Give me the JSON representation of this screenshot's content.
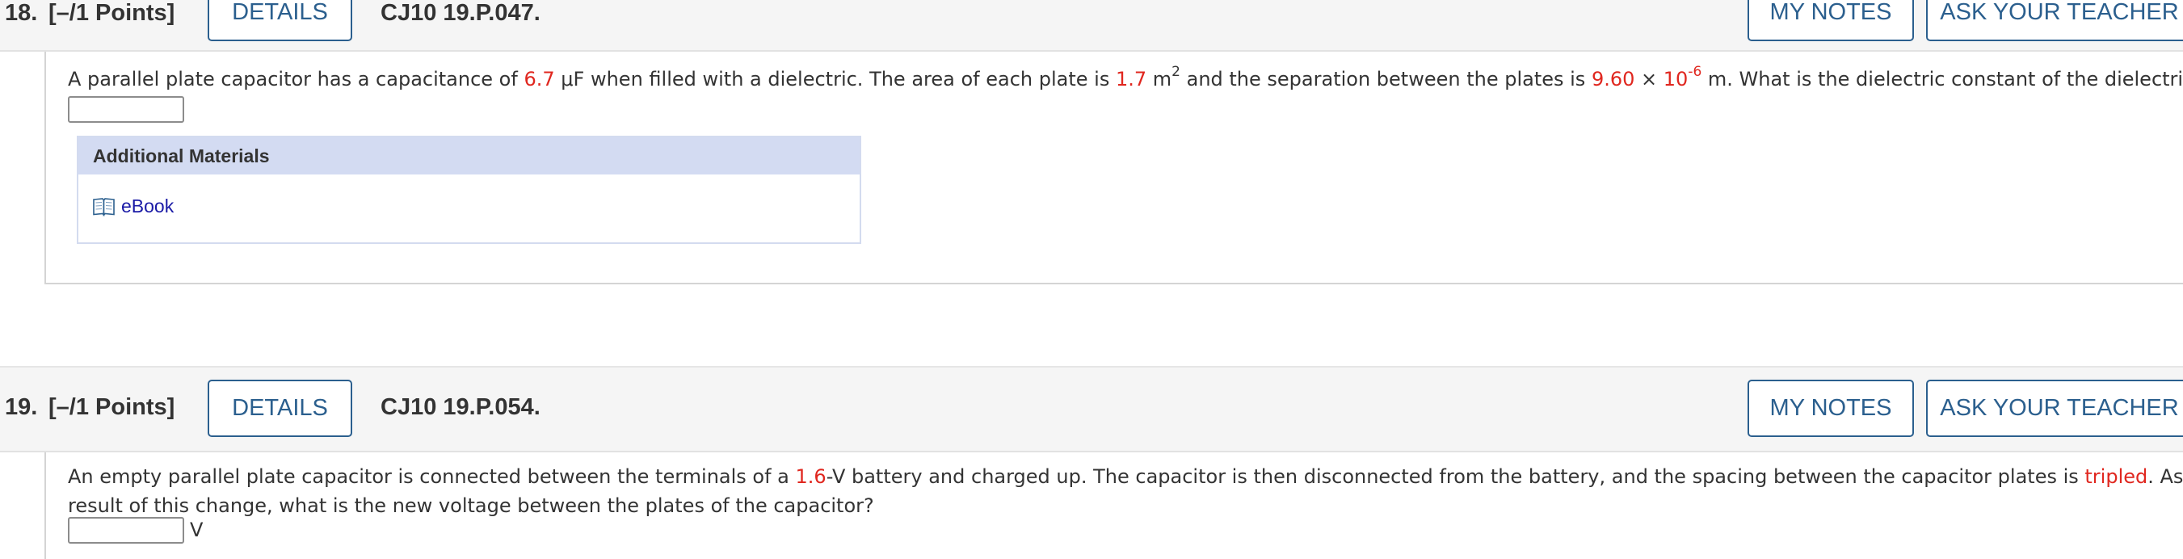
{
  "q18": {
    "number": "18.",
    "points": "[–/1 Points]",
    "details_label": "DETAILS",
    "code": "CJ10 19.P.047.",
    "my_notes_label": "MY NOTES",
    "ask_teacher_label": "ASK YOUR TEACHER",
    "text_1": "A parallel plate capacitor has a capacitance of ",
    "capacitance": "6.7",
    "text_2": " μF when filled with a dielectric. The area of each plate is ",
    "area": "1.7",
    "text_3": " m",
    "area_exp": "2",
    "text_4": " and the separation between the plates is ",
    "separation_mantissa": "9.60",
    "times": " × ",
    "separation_base": "10",
    "separation_exp": "-6",
    "text_5": " m. What is the dielectric constant of the dielectric?",
    "answer_value": "",
    "additional_materials_title": "Additional Materials",
    "ebook_label": "eBook",
    "ebook_icon": "open-book-icon"
  },
  "q19": {
    "number": "19.",
    "points": "[–/1 Points]",
    "details_label": "DETAILS",
    "code": "CJ10 19.P.054.",
    "my_notes_label": "MY NOTES",
    "ask_teacher_label": "ASK YOUR TEACHER",
    "line1_a": "An empty parallel plate capacitor is connected between the terminals of a ",
    "voltage": "1.6",
    "line1_b": "-V battery and charged up. The capacitor is then disconnected from the battery, and the spacing between the capacitor plates is ",
    "change": "tripled",
    "line1_c": ". As a",
    "line2": "result of this change, what is the new voltage between the plates of the capacitor?",
    "answer_value": "",
    "unit": "V"
  },
  "colors": {
    "button_border": "#2b5f8e",
    "variable_red": "#e0271f",
    "materials_header": "#d3dbf2",
    "link_blue": "#1a1aa6"
  }
}
